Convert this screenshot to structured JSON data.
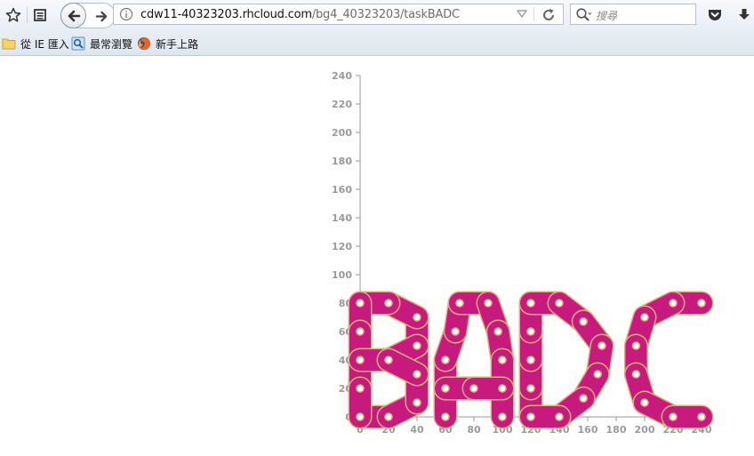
{
  "toolbar": {
    "url_host": "cdw11-40323203.rhcloud.com",
    "url_path": "/bg4_40323203/taskBADC",
    "search_placeholder": "搜尋"
  },
  "bookmarks": [
    {
      "label": "從 IE 匯入",
      "icon": "folder-icon"
    },
    {
      "label": "最常瀏覽",
      "icon": "most-visited-icon"
    },
    {
      "label": "新手上路",
      "icon": "firefox-icon"
    }
  ],
  "colors": {
    "chain_fill": "#c8197e",
    "chain_stroke": "#d6b27c",
    "axis": "#9a9a9a"
  },
  "chart_data": {
    "type": "other",
    "x_ticks": [
      0,
      20,
      40,
      60,
      80,
      100,
      120,
      140,
      160,
      180,
      200,
      220,
      240
    ],
    "y_ticks": [
      0,
      20,
      40,
      60,
      80,
      100,
      120,
      140,
      160,
      180,
      200,
      220,
      240
    ],
    "letters": [
      {
        "name": "B",
        "links": [
          [
            0,
            0,
            20,
            0
          ],
          [
            20,
            0,
            40,
            10
          ],
          [
            40,
            10,
            40,
            30
          ],
          [
            40,
            30,
            40,
            50
          ],
          [
            40,
            50,
            40,
            70
          ],
          [
            40,
            70,
            20,
            80
          ],
          [
            20,
            80,
            0,
            80
          ],
          [
            0,
            80,
            0,
            60
          ],
          [
            0,
            60,
            0,
            40
          ],
          [
            0,
            40,
            0,
            20
          ],
          [
            0,
            20,
            0,
            0
          ],
          [
            0,
            40,
            20,
            40
          ],
          [
            20,
            40,
            40,
            50
          ],
          [
            20,
            40,
            40,
            30
          ]
        ]
      },
      {
        "name": "A",
        "links": [
          [
            60,
            0,
            60,
            20
          ],
          [
            60,
            20,
            60,
            40
          ],
          [
            60,
            40,
            67,
            60
          ],
          [
            67,
            60,
            70,
            80
          ],
          [
            70,
            80,
            90,
            80
          ],
          [
            90,
            80,
            97,
            60
          ],
          [
            97,
            60,
            100,
            40
          ],
          [
            100,
            40,
            100,
            20
          ],
          [
            100,
            20,
            100,
            0
          ],
          [
            60,
            20,
            80,
            20
          ],
          [
            80,
            20,
            100,
            20
          ]
        ]
      },
      {
        "name": "D",
        "links": [
          [
            120,
            0,
            120,
            20
          ],
          [
            120,
            20,
            120,
            40
          ],
          [
            120,
            40,
            120,
            60
          ],
          [
            120,
            60,
            120,
            80
          ],
          [
            120,
            80,
            140,
            80
          ],
          [
            140,
            80,
            157,
            67
          ],
          [
            157,
            67,
            170,
            50
          ],
          [
            170,
            50,
            167,
            30
          ],
          [
            167,
            30,
            157,
            13
          ],
          [
            157,
            13,
            140,
            0
          ],
          [
            140,
            0,
            120,
            0
          ]
        ]
      },
      {
        "name": "C",
        "links": [
          [
            240,
            80,
            220,
            80
          ],
          [
            220,
            80,
            200,
            70
          ],
          [
            200,
            70,
            194,
            50
          ],
          [
            194,
            50,
            194,
            30
          ],
          [
            194,
            30,
            200,
            10
          ],
          [
            200,
            10,
            220,
            0
          ],
          [
            220,
            0,
            240,
            0
          ]
        ]
      }
    ]
  }
}
